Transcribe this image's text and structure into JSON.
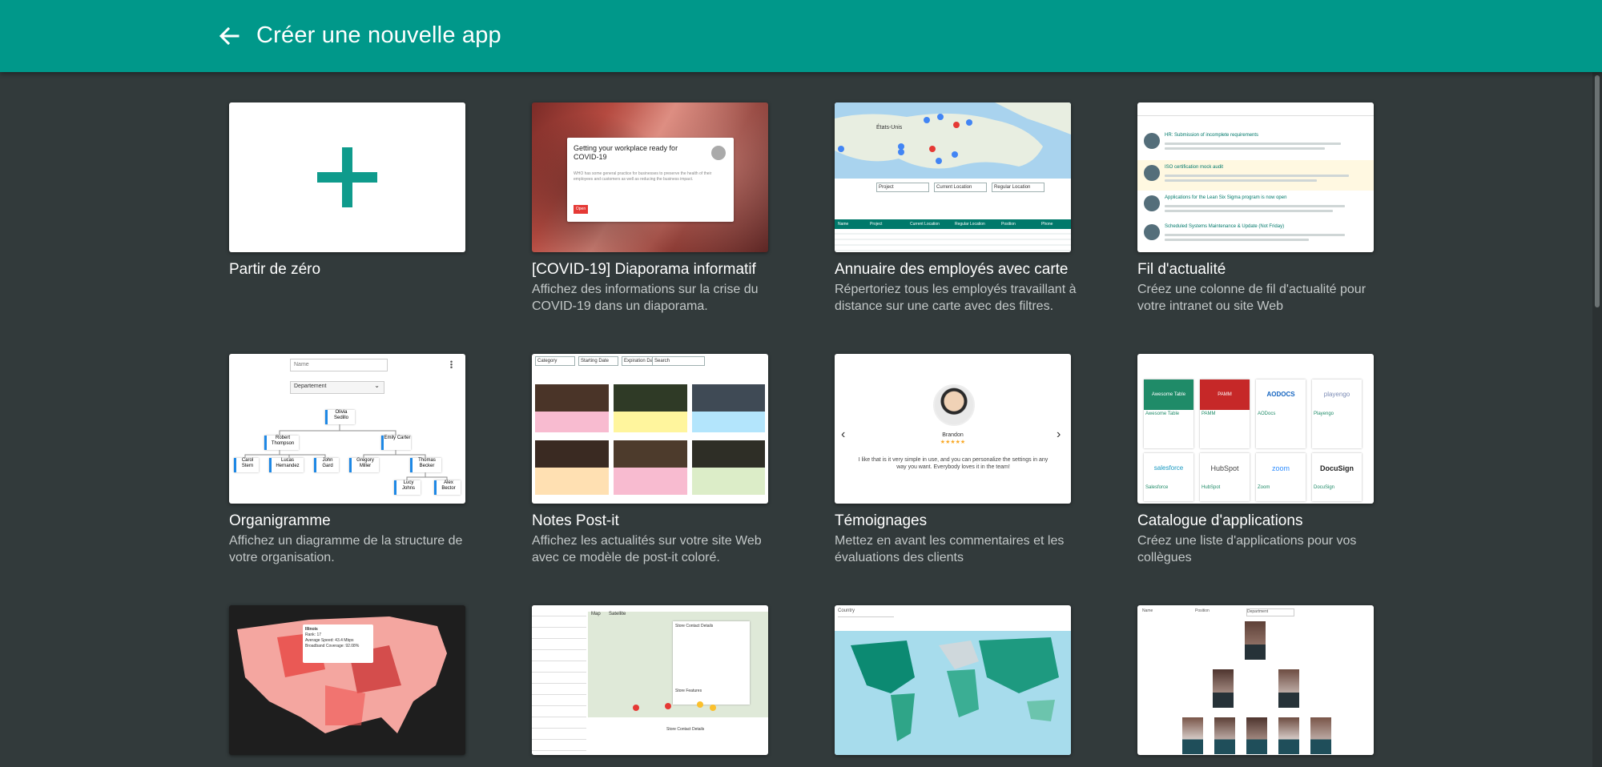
{
  "header": {
    "title": "Créer une nouvelle app"
  },
  "colors": {
    "accent": "#00988a",
    "background": "#323a3b"
  },
  "templates": [
    {
      "id": "blank",
      "title": "Partir de zéro",
      "description": ""
    },
    {
      "id": "covid",
      "title": "[COVID-19] Diaporama informatif",
      "description": "Affichez des informations sur la crise du COVID-19 dans un diaporama.",
      "thumb": {
        "card_title": "Getting your workplace ready for COVID-19",
        "card_text": "WHO has some general practice for businesses to preserve the health of their employees and customers as well as reducing the business impact.",
        "button": "Open"
      }
    },
    {
      "id": "directory",
      "title": "Annuaire des employés avec carte",
      "description": "Répertoriez tous les employés travaillant à distance sur une carte avec des filtres.",
      "thumb": {
        "map_label": "États-Unis",
        "filters": [
          "Project",
          "Current Location",
          "Regular Location"
        ],
        "columns": [
          "Name",
          "Project",
          "Current Location",
          "Regular Location",
          "Position",
          "Phone"
        ]
      }
    },
    {
      "id": "news",
      "title": "Fil d'actualité",
      "description": "Créez une colonne de fil d'actualité pour votre intranet ou site Web",
      "thumb": {
        "items": [
          "HR: Submission of incomplete requirements",
          "ISO certification mock audit",
          "Applications for the Lean Six Sigma program is now open",
          "Scheduled Systems Maintenance & Update (Not Friday)"
        ]
      }
    },
    {
      "id": "org",
      "title": "Organigramme",
      "description": "Affichez un diagramme de la structure de votre organisation.",
      "thumb": {
        "name_placeholder": "Name",
        "department": "Departement",
        "people": [
          "Olivia Sedillo",
          "Robert Thompson",
          "Emily Carter",
          "Carol Stern",
          "Lucas Hernandez",
          "John Gard",
          "Gregory Miller",
          "Thomas Becker",
          "Lucy Johns",
          "Alex Bector"
        ]
      }
    },
    {
      "id": "postit",
      "title": "Notes Post-it",
      "description": "Affichez les actualités sur votre site Web avec ce modèle de post-it coloré.",
      "thumb": {
        "filters": [
          "Category",
          "Starting Date",
          "Expiration Date",
          "Search"
        ]
      }
    },
    {
      "id": "testimonials",
      "title": "Témoignages",
      "description": "Mettez en avant les commentaires et les évaluations des clients",
      "thumb": {
        "name": "Brandon",
        "stars": "★★★★★",
        "quote": "I like that is it very simple in use, and you can personalize the settings in any way you want. Everybody loves it in the team!"
      }
    },
    {
      "id": "catalog",
      "title": "Catalogue d'applications",
      "description": "Créez une liste d'applications pour vos collègues",
      "thumb": {
        "apps": [
          {
            "name": "Awesome Table",
            "logo": "Awesome Table",
            "color": "#1f8b68"
          },
          {
            "name": "PAMM",
            "logo": "PAMM",
            "color": "#c62828"
          },
          {
            "name": "AODocs",
            "logo": "AODOCS",
            "color": "#1565c0"
          },
          {
            "name": "Playengo",
            "logo": "playengo",
            "color": "#7b8bb5"
          },
          {
            "name": "Salesforce",
            "logo": "salesforce",
            "color": "#1798c1"
          },
          {
            "name": "HubSpot",
            "logo": "HubSpot",
            "color": "#444444"
          },
          {
            "name": "Zoom",
            "logo": "zoom",
            "color": "#2d8cff"
          },
          {
            "name": "DocuSign",
            "logo": "DocuSign",
            "color": "#222222"
          }
        ]
      }
    },
    {
      "id": "usmap",
      "title": "",
      "description": "",
      "thumb": {
        "popup_title": "Illinois",
        "popup_lines": [
          "Rank: 17",
          "Average Speed: 43.4 Mbps",
          "Broadband Coverage: 92.08%"
        ]
      }
    },
    {
      "id": "storeloc",
      "title": "",
      "description": "",
      "thumb": {
        "tabs": [
          "Map",
          "Satellite"
        ],
        "panel_title": "Store Contact Details",
        "bottom_title": "Store Contact Details",
        "features": "Store Features"
      }
    },
    {
      "id": "worldmap",
      "title": "",
      "description": "",
      "thumb": {
        "filter": "Country"
      }
    },
    {
      "id": "org2",
      "title": "",
      "description": "",
      "thumb": {
        "filters": [
          "Name",
          "Position",
          "Department"
        ]
      }
    }
  ]
}
